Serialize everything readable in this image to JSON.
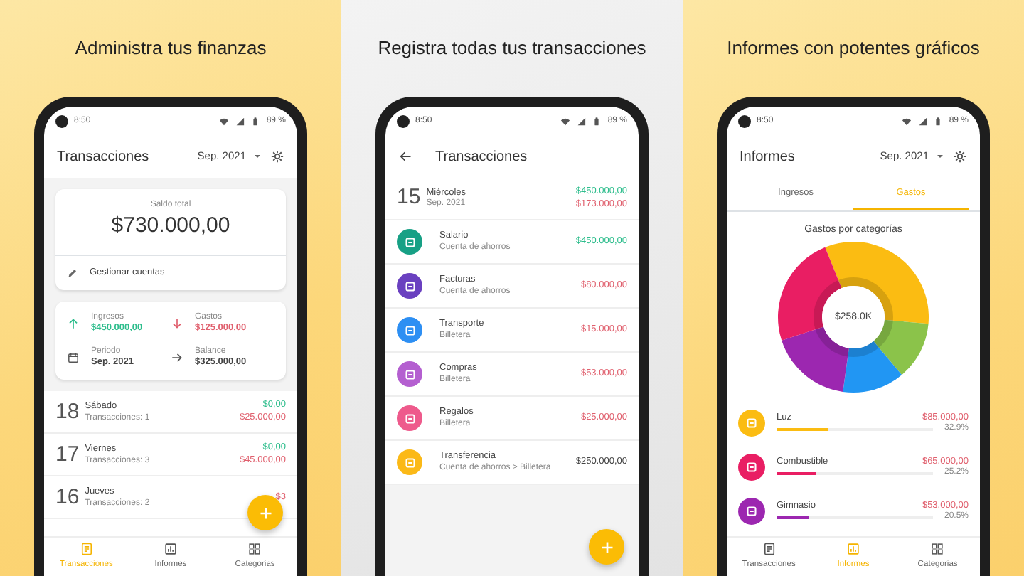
{
  "panels": [
    {
      "kind": "overview",
      "caption": "Administra tus finanzas",
      "status": {
        "time": "8:50",
        "battery": "89 %"
      },
      "title": "Transacciones",
      "period": "Sep. 2021",
      "balance_label": "Saldo total",
      "balance": "$730.000,00",
      "manage": "Gestionar cuentas",
      "stats": [
        {
          "kind": "income",
          "label": "Ingresos",
          "value": "$450.000,00"
        },
        {
          "kind": "expense",
          "label": "Gastos",
          "value": "$125.000,00"
        },
        {
          "kind": "period",
          "label": "Periodo",
          "value": "Sep. 2021"
        },
        {
          "kind": "balance",
          "label": "Balance",
          "value": "$325.000,00"
        }
      ],
      "days": [
        {
          "day": "18",
          "weekday": "Sábado",
          "count": "Transacciones: 1",
          "income": "$0,00",
          "expense": "$25.000,00"
        },
        {
          "day": "17",
          "weekday": "Viernes",
          "count": "Transacciones: 3",
          "income": "$0,00",
          "expense": "$45.000,00"
        },
        {
          "day": "16",
          "weekday": "Jueves",
          "count": "Transacciones: 2",
          "expense": "$3"
        }
      ],
      "nav": [
        {
          "label": "Transacciones",
          "selected": true
        },
        {
          "label": "Informes",
          "selected": false
        },
        {
          "label": "Categorias",
          "selected": false
        }
      ]
    },
    {
      "kind": "detail",
      "caption": "Registra todas tus transacciones",
      "status": {
        "time": "8:50",
        "battery": "89 %"
      },
      "title": "Transacciones",
      "header": {
        "day": "15",
        "weekday": "Miércoles",
        "period": "Sep. 2021",
        "income": "$450.000,00",
        "expense": "$173.000,00"
      },
      "transactions": [
        {
          "kind": "income",
          "name": "Salario",
          "account": "Cuenta de ahorros",
          "amount": "$450.000,00",
          "color": "#17a085"
        },
        {
          "kind": "expense",
          "name": "Facturas",
          "account": "Cuenta de ahorros",
          "amount": "$80.000,00",
          "color": "#6a40c0"
        },
        {
          "kind": "expense",
          "name": "Transporte",
          "account": "Billetera",
          "amount": "$15.000,00",
          "color": "#2d8ff3"
        },
        {
          "kind": "expense",
          "name": "Compras",
          "account": "Billetera",
          "amount": "$53.000,00",
          "color": "#b45fd0"
        },
        {
          "kind": "expense",
          "name": "Regalos",
          "account": "Billetera",
          "amount": "$25.000,00",
          "color": "#ee5a8c"
        },
        {
          "kind": "transfer",
          "name": "Transferencia",
          "account": "Cuenta de ahorros > Billetera",
          "amount": "$250.000,00",
          "color": "#fbb917"
        }
      ]
    },
    {
      "kind": "reports",
      "caption": "Informes con potentes gráficos",
      "status": {
        "time": "8:50",
        "battery": "89 %"
      },
      "title": "Informes",
      "period": "Sep. 2021",
      "tabs": [
        {
          "label": "Ingresos",
          "selected": false
        },
        {
          "label": "Gastos",
          "selected": true
        }
      ],
      "chart_title": "Gastos por categorías",
      "chart_center": "$258.0K",
      "categories": [
        {
          "name": "Luz",
          "amount": "$85.000,00",
          "percent": "32.9%",
          "level": 0.329,
          "color": "#fbbc12"
        },
        {
          "name": "Combustible",
          "amount": "$65.000,00",
          "percent": "25.2%",
          "level": 0.252,
          "color": "#e91e63"
        },
        {
          "name": "Gimnasio",
          "amount": "$53.000,00",
          "percent": "20.5%",
          "level": 0.205,
          "color": "#9c27b0"
        }
      ],
      "nav": [
        {
          "label": "Transacciones",
          "selected": false
        },
        {
          "label": "Informes",
          "selected": true
        },
        {
          "label": "Categorias",
          "selected": false
        }
      ]
    }
  ]
}
